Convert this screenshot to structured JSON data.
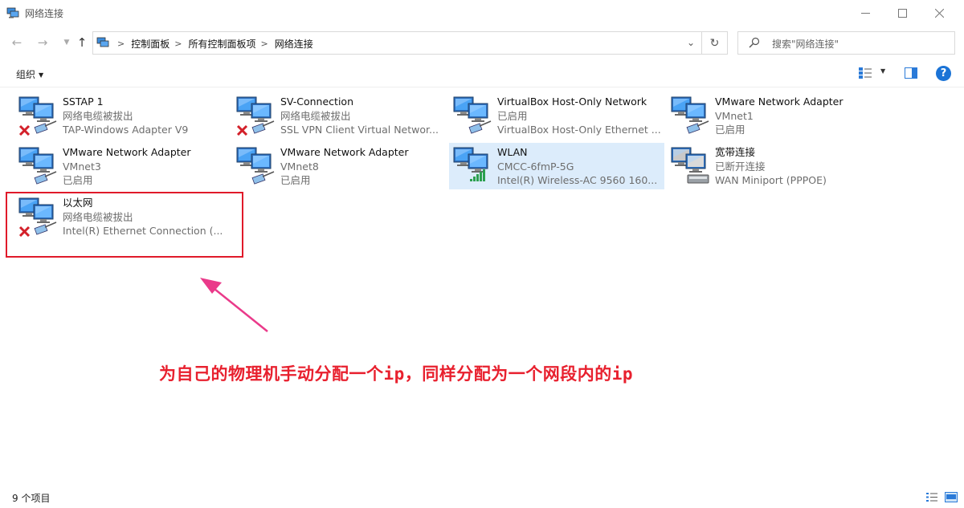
{
  "window": {
    "title": "网络连接"
  },
  "address": {
    "segments": [
      "控制面板",
      "所有控制面板项",
      "网络连接"
    ]
  },
  "search": {
    "placeholder": "搜索\"网络连接\""
  },
  "toolbar": {
    "organize_label": "组织"
  },
  "items": [
    {
      "name": "SSTAP 1",
      "status": "网络电缆被拔出",
      "device": "TAP-Windows Adapter V9",
      "state": "disconnected"
    },
    {
      "name": "SV-Connection",
      "status": "网络电缆被拔出",
      "device": "SSL VPN Client Virtual Networ...",
      "state": "disconnected"
    },
    {
      "name": "VirtualBox Host-Only Network",
      "status": "已启用",
      "device": "VirtualBox Host-Only Ethernet ...",
      "state": "enabled"
    },
    {
      "name": "VMware Network Adapter",
      "status": "VMnet1",
      "device": "已启用",
      "state": "enabled"
    },
    {
      "name": "VMware Network Adapter",
      "status": "VMnet3",
      "device": "已启用",
      "state": "enabled"
    },
    {
      "name": "VMware Network Adapter",
      "status": "VMnet8",
      "device": "已启用",
      "state": "enabled"
    },
    {
      "name": "WLAN",
      "status": "CMCC-6fmP-5G",
      "device": "Intel(R) Wireless-AC 9560 160...",
      "state": "wireless"
    },
    {
      "name": "宽带连接",
      "status": "已断开连接",
      "device": "WAN Miniport (PPPOE)",
      "state": "broadband"
    },
    {
      "name": "以太网",
      "status": "网络电缆被拔出",
      "device": "Intel(R) Ethernet Connection (...",
      "state": "disconnected"
    }
  ],
  "annotation": {
    "text": "为自己的物理机手动分配一个ip，同样分配为一个网段内的ip",
    "color": "#e8202e"
  },
  "status_bar": {
    "count": "9 个项目"
  },
  "colors": {
    "accent": "#1a73d6",
    "selection": "#dcecfb",
    "highlight": "#e01a2a"
  }
}
